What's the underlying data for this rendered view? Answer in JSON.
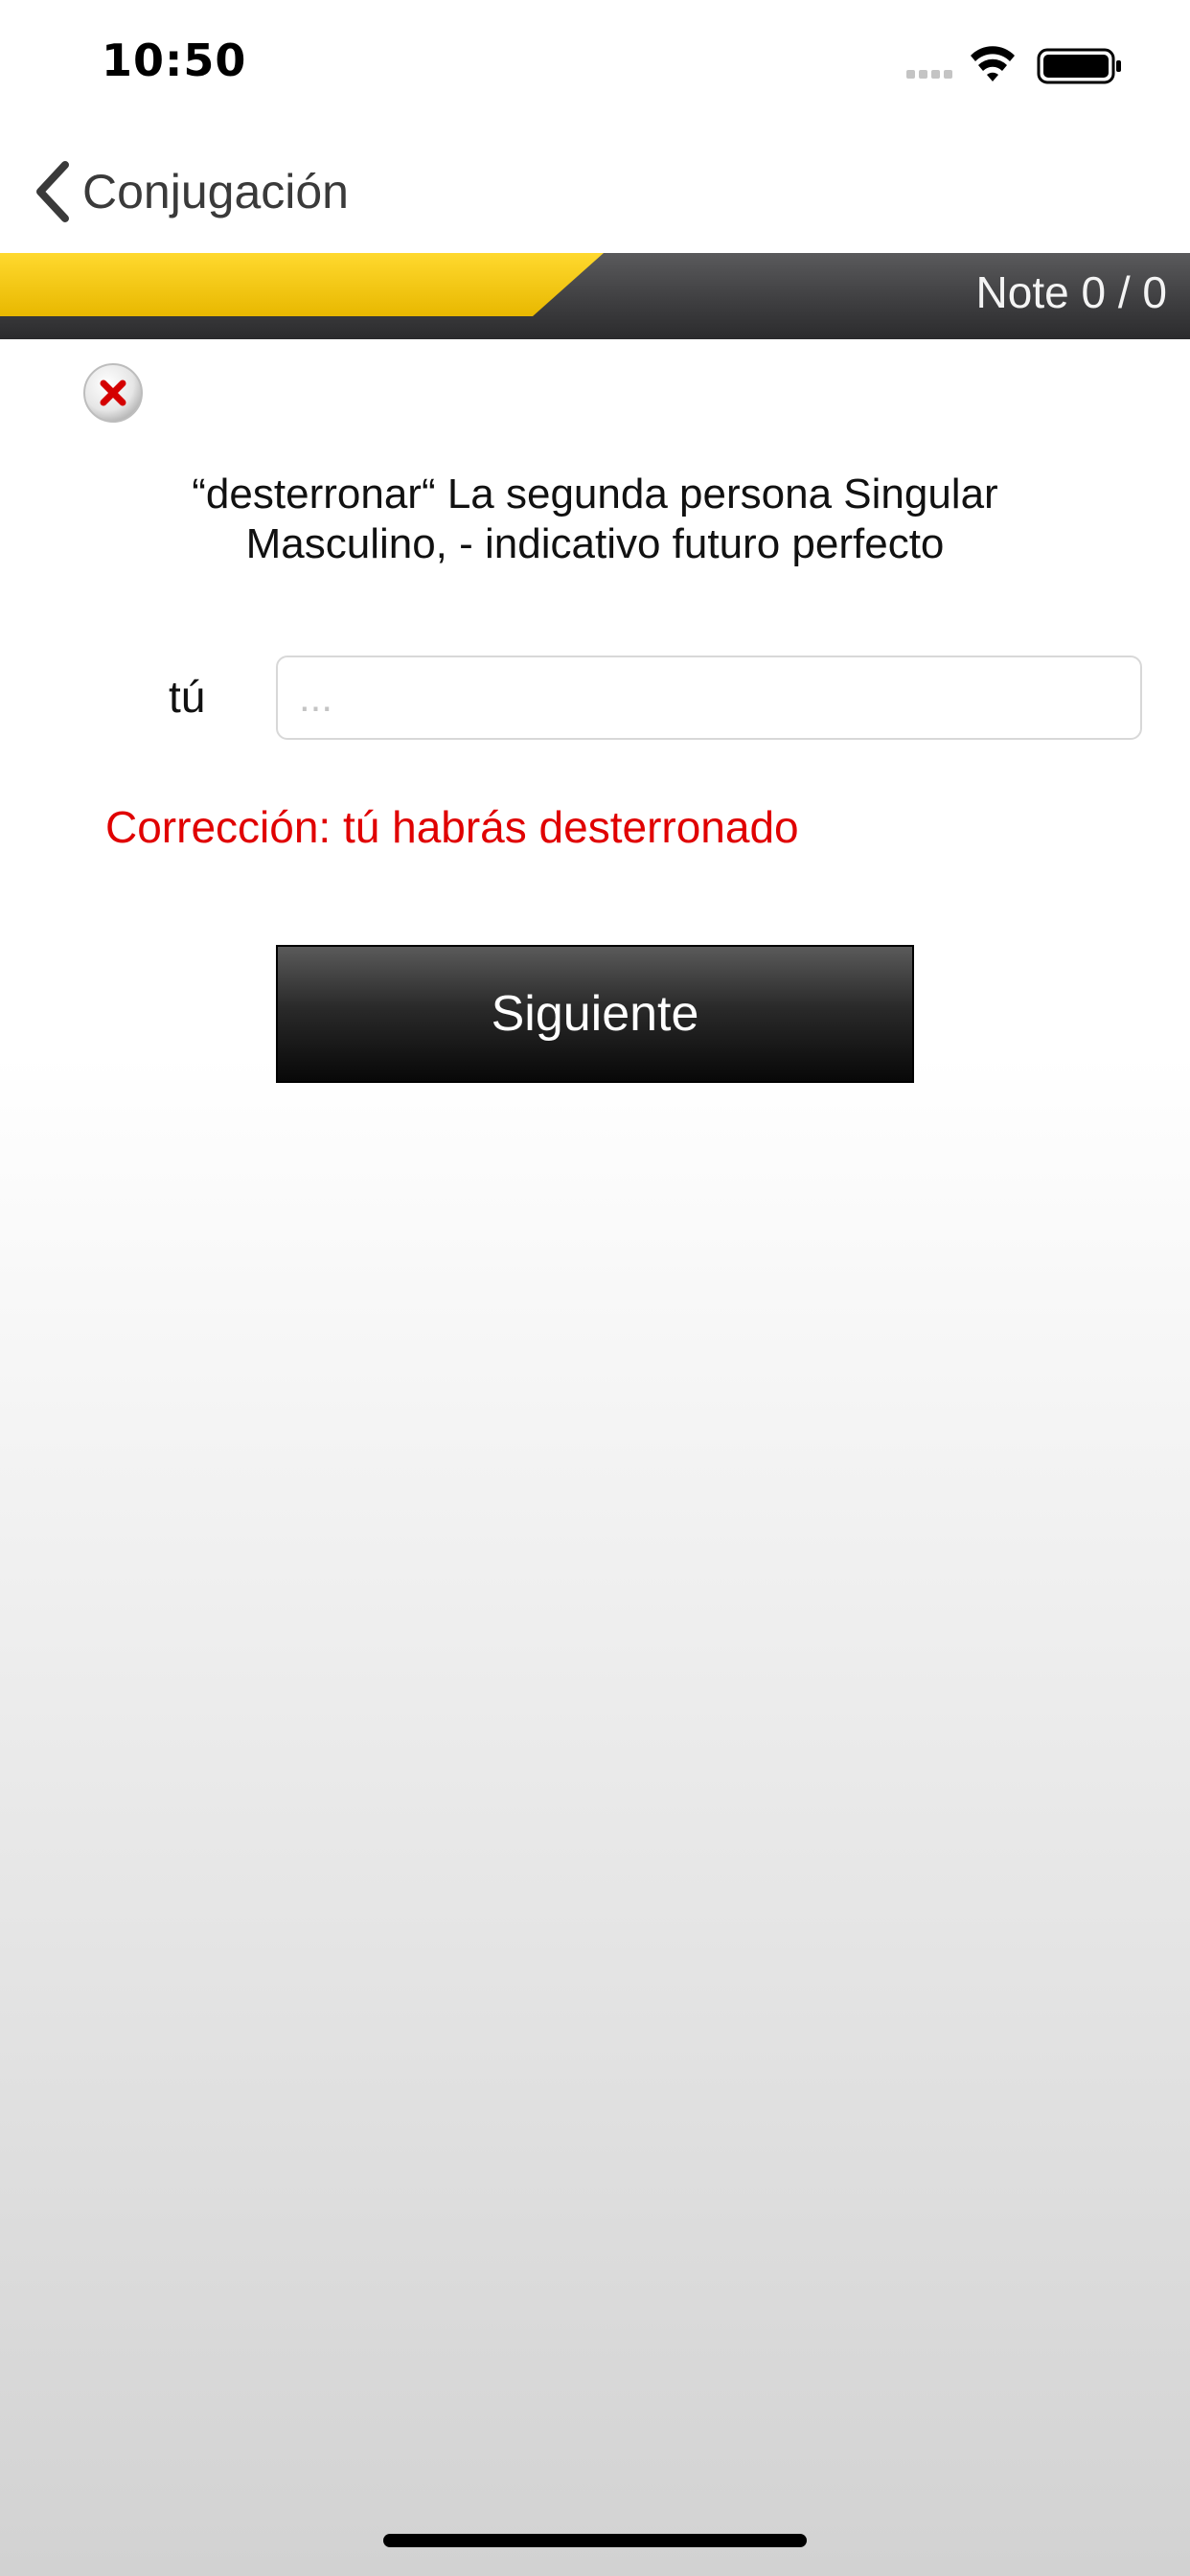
{
  "status_bar": {
    "time": "10:50",
    "icons": [
      "cellular-signal-icon",
      "wifi-icon",
      "battery-icon"
    ]
  },
  "nav": {
    "back_label": "Conjugación",
    "back_icon": "chevron-left-icon"
  },
  "banner": {
    "score_text": "Note 0 / 0",
    "accent_color": "#f2c200"
  },
  "exercise": {
    "result_icon": "incorrect-x-icon",
    "question": "“desterronar“  La segunda persona Singular Masculino, - indicativo futuro perfecto",
    "pronoun": "tú",
    "input_value": "",
    "input_placeholder": "...",
    "correction": "Corrección: tú habrás desterronado",
    "correction_color": "#e00000",
    "next_label": "Siguiente"
  }
}
